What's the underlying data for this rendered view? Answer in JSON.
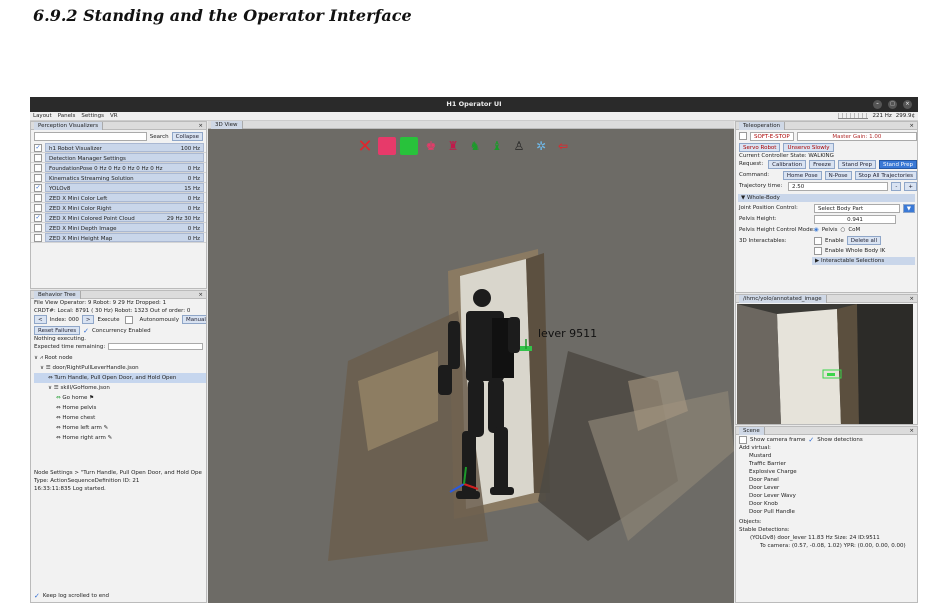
{
  "section_heading": "6.9.2   Standing and the Operator Interface",
  "window": {
    "title": "H1 Operator UI",
    "menus": [
      "Layout",
      "Panels",
      "Settings",
      "VR"
    ],
    "status": [
      "221 Hz",
      "299.9¢"
    ]
  },
  "perception": {
    "tab": "Perception Visualizers",
    "search_btn": "Search",
    "collapse_btn": "Collapse",
    "items": [
      {
        "label": "h1 Robot Visualizer",
        "rate": "100 Hz",
        "checked": true
      },
      {
        "label": "Detection Manager Settings",
        "rate": "",
        "checked": false
      },
      {
        "label": "FoundationPose 0 Hz 0 Hz 0 Hz 0 Hz 0 Hz",
        "rate": "0 Hz",
        "checked": false
      },
      {
        "label": "Kinematics Streaming Solution",
        "rate": "0 Hz",
        "checked": false
      },
      {
        "label": "YOLOv8",
        "rate": "15 Hz",
        "checked": true
      },
      {
        "label": "ZED X Mini Color Left",
        "rate": "0 Hz",
        "checked": false
      },
      {
        "label": "ZED X Mini Color Right",
        "rate": "0 Hz",
        "checked": false
      },
      {
        "label": "ZED X Mini Colored Point Cloud",
        "rate": "29 Hz 30 Hz",
        "checked": true
      },
      {
        "label": "ZED X Mini Depth Image",
        "rate": "0 Hz",
        "checked": false
      },
      {
        "label": "ZED X Mini Height Map",
        "rate": "0 Hz",
        "checked": false
      }
    ]
  },
  "behavior": {
    "tab": "Behavior Tree",
    "menu": "File   View   Operator:  9  Robot:  9    29 Hz  Dropped:   1",
    "crdt": "CRDT#: Local: 8791 ( 30 Hz)  Robot: 1323  Out of order: 0",
    "index": "Index: 000",
    "execute": "Execute",
    "autonomously": "Autonomously",
    "manually": "Manually",
    "reset": "Reset Failures",
    "concurrency": "Concurrency Enabled",
    "nothing": "Nothing executing.",
    "expected": "Expected time remaining:",
    "tree": [
      "Root node",
      "door/RightPullLeverHandle.json",
      "Turn Handle, Pull Open Door, and Hold Open",
      "skill/GoHome.json",
      "Go home",
      "Home pelvis",
      "Home chest",
      "Home left arm",
      "Home right arm"
    ],
    "node_settings": "Node Settings > \"Turn Handle, Pull Open Door, and Hold Ope",
    "type": "Type: ActionSequenceDefinition   ID: 21",
    "log": "16:33:11:835 Log started.",
    "keep_log": "Keep log scrolled to end"
  },
  "view3d": {
    "tab": "3D View",
    "label": "lever 9511"
  },
  "teleop": {
    "tab": "Teleoperation",
    "estop": "SOFT-E-STOP",
    "master_gain": "Master Gain: 1.00",
    "servo": "Servo Robot",
    "unservo": "Unservo Slowly",
    "state": "Current Controller State: WALKING",
    "request_label": "Request:",
    "requests": [
      "Calibration",
      "Freeze",
      "Stand Prep",
      "Stand Prep"
    ],
    "command_label": "Command:",
    "commands": [
      "Home Pose",
      "N-Pose",
      "Stop All Trajectories"
    ],
    "traj_label": "Trajectory time:",
    "traj_value": "2.50",
    "whole_body": "Whole-Body",
    "joint_label": "Joint Position Control:",
    "joint_value": "Select Body Part",
    "pelvis_label": "Pelvis Height:",
    "pelvis_value": "0.941",
    "mode_label": "Pelvis Height Control Mode:",
    "mode_opts": [
      "Pelvis",
      "CoM"
    ],
    "interact_label": "3D Interactables:",
    "enable": "Enable",
    "delete_all": "Delete all",
    "enable_ik": "Enable Whole Body IK",
    "interactable_sel": "Interactable Selections"
  },
  "camera": {
    "tab": "/ihmc/yolo/annotated_image"
  },
  "scene": {
    "tab": "Scene",
    "show_frame": "Show camera frame",
    "show_det": "Show detections",
    "add_virtual": "Add virtual:",
    "virtuals": [
      "Mustard",
      "Traffic Barrier",
      "Explosive Charge",
      "Door Panel",
      "Door Lever",
      "Door Lever Wavy",
      "Door Knob",
      "Door Pull Handle"
    ],
    "objects": "Objects:",
    "stable": "Stable Detections:",
    "det1": "(YOLOv8) door_lever 11.83 Hz Size: 24 ID:9511",
    "det2": "To camera: (0.57, -0.08, 1.02) YPR: (0.00, 0.00, 0.00)"
  },
  "colors": {
    "accent": "#3a79d6",
    "titlebar": "#2a2a2a",
    "viz_bar": "#c9d6ea"
  }
}
